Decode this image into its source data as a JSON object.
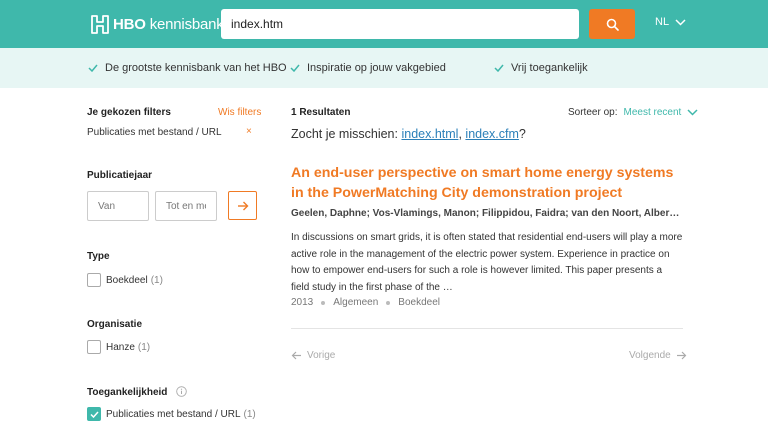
{
  "header": {
    "logo_bold": "HBO",
    "logo_light": "kennisbank",
    "search_value": "index.htm",
    "language": "NL"
  },
  "usp": [
    "De grootste kennisbank van het HBO",
    "Inspiratie op jouw vakgebied",
    "Vrij toegankelijk"
  ],
  "sidebar": {
    "selected_title": "Je gekozen filters",
    "clear_label": "Wis filters",
    "active_filter": "Publicaties met bestand / URL",
    "remove_symbol": "×",
    "year_title": "Publicatiejaar",
    "year_from_placeholder": "Van",
    "year_to_placeholder": "Tot en met",
    "type_title": "Type",
    "type_option": {
      "label": "Boekdeel",
      "count": "(1)",
      "checked": false
    },
    "org_title": "Organisatie",
    "org_option": {
      "label": "Hanze",
      "count": "(1)",
      "checked": false
    },
    "access_title": "Toegankelijkheid",
    "access_option": {
      "label": "Publicaties met bestand / URL",
      "count": "(1)",
      "checked": true
    }
  },
  "main": {
    "results_count": "1 Resultaten",
    "sort_label": "Sorteer op:",
    "sort_value": "Meest recent",
    "suggest_prefix": "Zocht je misschien:",
    "suggest_links": [
      "index.html",
      "index.cfm"
    ],
    "suggest_sep": ",",
    "suggest_suffix": "?",
    "result": {
      "title": "An end-user perspective on smart home energy systems in the PowerMatching City demonstration project",
      "authors": "Geelen, Daphne; Vos-Vlamings, Manon; Filippidou, Faidra; van den Noort, Albert; van Grootel, Marijn",
      "abstract": "In discussions on smart grids, it is often stated that residential end-users will play a more active role in the management of the electric power system. Experience in practice on how to empower end-users for such a role is however limited. This paper presents a field study in the first phase of the …",
      "year": "2013",
      "category": "Algemeen",
      "type": "Boekdeel"
    },
    "prev_label": "Vorige",
    "next_label": "Volgende"
  },
  "colors": {
    "teal": "#3fb8ab",
    "orange": "#f07a24",
    "link_blue": "#2b7fb8",
    "usp_bg": "#e7f6f4"
  },
  "icons": [
    "hbo-logo-icon",
    "search-icon",
    "chevron-down-icon",
    "check-icon",
    "arrow-right-icon",
    "info-icon",
    "arrow-left-icon"
  ]
}
